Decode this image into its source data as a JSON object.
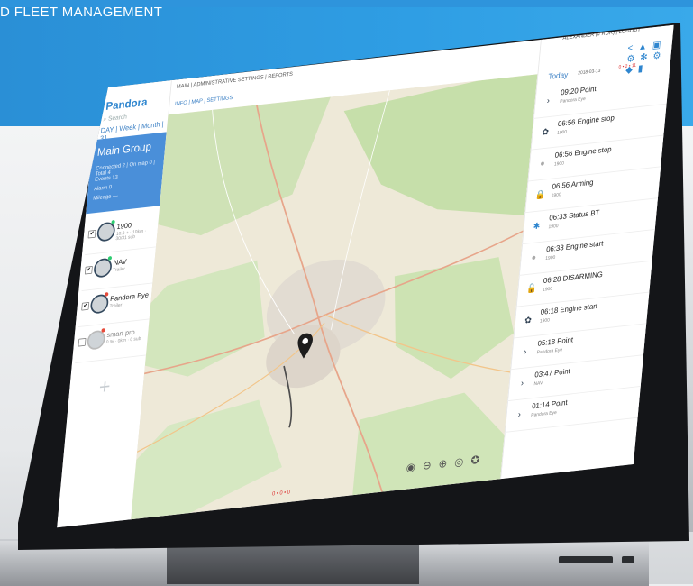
{
  "banner": {
    "headline": "D FLEET MANAGEMENT"
  },
  "app": {
    "logo": "Pandora",
    "search_placeholder": "Search",
    "periods": [
      "DAY",
      "Week",
      "Month",
      "31"
    ],
    "topnav": "MAIN | ADMINISTRATIVE SETTINGS | REPORTS",
    "subnav": "INFO | MAP | SETTINGS",
    "user": "ALEXANDER (# RUR) | LOGOUT",
    "toolbar_icons": "< ▲ ▣ ⚙ ✻ ⚙ ◆ ▮"
  },
  "group": {
    "title": "Main Group",
    "rows": [
      "Connected 2 | On map 0 | Total 4",
      "Events    13",
      "Alarm     0",
      "Mileage   —"
    ]
  },
  "devices": [
    {
      "name": "1900",
      "sub": "10.3 +  · 10km · 30/31 sub",
      "dot": "#2ecc71",
      "checked": "✔"
    },
    {
      "name": "NAV",
      "sub": "Trailer",
      "dot": "#2ecc71",
      "checked": "✔"
    },
    {
      "name": "Pandora Eye",
      "sub": "Trailer",
      "dot": "#e74c3c",
      "checked": "✔"
    },
    {
      "name": "smart pro",
      "sub": "0 % · 0km · 0 sub",
      "dot": "#e74c3c",
      "checked": ""
    }
  ],
  "add_label": "+",
  "right": {
    "today": "Today",
    "date": "2018-03-13",
    "counts": "0 • 2 • 11"
  },
  "events": [
    {
      "time_title": "09:20 Point",
      "sub": "Pandora Eye",
      "icon": "›"
    },
    {
      "time_title": "06:56 Engine stop",
      "sub": "1900",
      "icon": "✿"
    },
    {
      "time_title": "06:56 Engine stop",
      "sub": "1900",
      "icon": "●"
    },
    {
      "time_title": "06:56 Arming",
      "sub": "1900",
      "icon": "🔒"
    },
    {
      "time_title": "06:33 Status BT",
      "sub": "1900",
      "icon": "✱"
    },
    {
      "time_title": "06:33 Engine start",
      "sub": "1900",
      "icon": "●"
    },
    {
      "time_title": "06:28 DISARMING",
      "sub": "1900",
      "icon": "🔓"
    },
    {
      "time_title": "06:18 Engine start",
      "sub": "1900",
      "icon": "✿"
    },
    {
      "time_title": "05:18 Point",
      "sub": "Pandora Eye",
      "icon": "›"
    },
    {
      "time_title": "03:47 Point",
      "sub": "NAV",
      "icon": "›"
    },
    {
      "time_title": "01:14 Point",
      "sub": "Pandora Eye",
      "icon": "›"
    }
  ],
  "map_controls": "◉ ⊖ ⊕ ◎ ✪",
  "map_counter": "0 • 0 • 0"
}
